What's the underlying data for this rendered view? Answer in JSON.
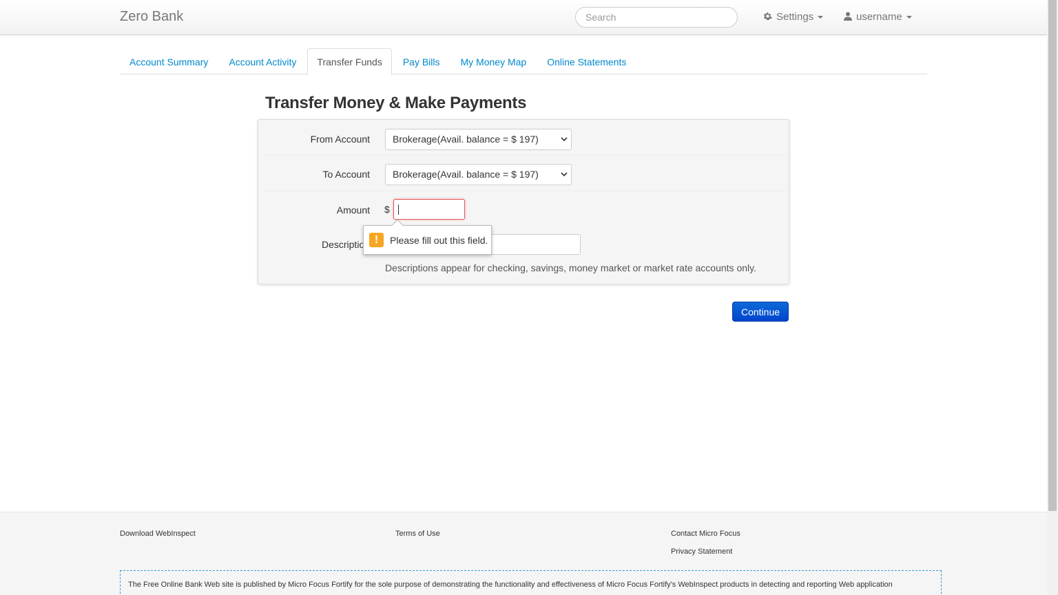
{
  "navbar": {
    "brand": "Zero Bank",
    "search_placeholder": "Search",
    "settings_label": "Settings",
    "user_label": "username"
  },
  "tabs": [
    {
      "label": "Account Summary",
      "active": false
    },
    {
      "label": "Account Activity",
      "active": false
    },
    {
      "label": "Transfer Funds",
      "active": true
    },
    {
      "label": "Pay Bills",
      "active": false
    },
    {
      "label": "My Money Map",
      "active": false
    },
    {
      "label": "Online Statements",
      "active": false
    }
  ],
  "page": {
    "title": "Transfer Money & Make Payments"
  },
  "form": {
    "from_account_label": "From Account",
    "from_account_value": "Brokerage(Avail. balance = $ 197)",
    "to_account_label": "To Account",
    "to_account_value": "Brokerage(Avail. balance = $ 197)",
    "amount_label": "Amount",
    "amount_prefix": "$",
    "amount_value": "",
    "description_label": "Description",
    "description_value": "",
    "description_help": "Descriptions appear for checking, savings, money market or market rate accounts only."
  },
  "validation": {
    "message": "Please fill out this field.",
    "icon": "warning-icon",
    "icon_color": "#f5a623"
  },
  "actions": {
    "continue_label": "Continue",
    "continue_color": "#0044cc"
  },
  "footer": {
    "download_link": "Download WebInspect",
    "terms_link": "Terms of Use",
    "contact_link": "Contact Micro Focus",
    "privacy_link": "Privacy Statement",
    "disclaimer": "The Free Online Bank Web site is published by Micro Focus Fortify for the sole purpose of demonstrating the functionality and effectiveness of Micro Focus Fortify's WebInspect products in detecting and reporting Web application"
  },
  "colors": {
    "link": "#0088cc",
    "invalid_border": "#e05555"
  }
}
